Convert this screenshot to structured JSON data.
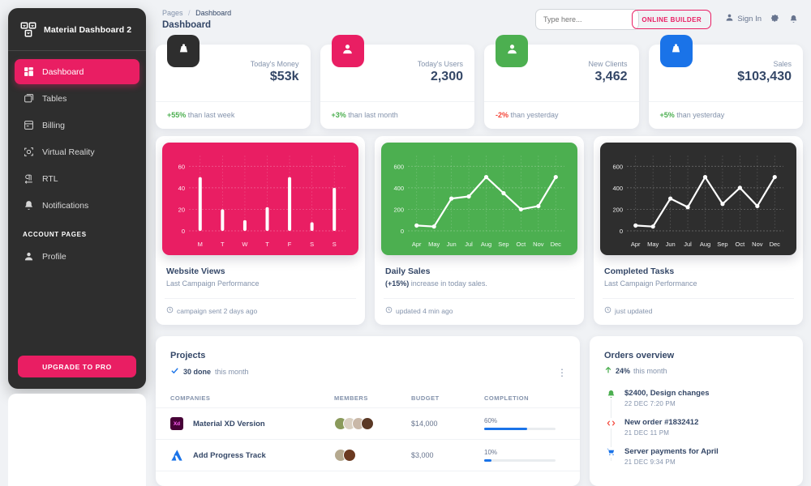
{
  "brand": {
    "name": "Material Dashboard 2",
    "logo_icon": "dashboard-logo-icon"
  },
  "sidebar": {
    "items": [
      {
        "label": "Dashboard",
        "icon": "grid-icon",
        "active": true
      },
      {
        "label": "Tables",
        "icon": "tables-icon",
        "active": false
      },
      {
        "label": "Billing",
        "icon": "credit-card-icon",
        "active": false
      },
      {
        "label": "Virtual Reality",
        "icon": "vr-icon",
        "active": false
      },
      {
        "label": "RTL",
        "icon": "rtl-icon",
        "active": false
      },
      {
        "label": "Notifications",
        "icon": "bell-icon",
        "active": false
      }
    ],
    "section_label": "ACCOUNT PAGES",
    "account_items": [
      {
        "label": "Profile",
        "icon": "person-icon",
        "active": false
      }
    ],
    "upgrade_label": "UPGRADE TO PRO"
  },
  "topbar": {
    "breadcrumb_root": "Pages",
    "breadcrumb_sep": "/",
    "breadcrumb_current": "Dashboard",
    "page_title": "Dashboard",
    "search_placeholder": "Type here...",
    "online_builder_label": "ONLINE BUILDER",
    "sign_in_label": "Sign In",
    "gear_icon": "gear-icon",
    "bell_icon": "bell-icon",
    "person_icon": "person-icon"
  },
  "stats": [
    {
      "label": "Today's Money",
      "value": "$53k",
      "delta": "+55%",
      "delta_color": "#4caf50",
      "foot_rest": " than last week",
      "icon": "weight-icon",
      "bg": "#2e2e2e"
    },
    {
      "label": "Today's Users",
      "value": "2,300",
      "delta": "+3%",
      "delta_color": "#4caf50",
      "foot_rest": " than last month",
      "icon": "person-icon",
      "bg": "#e91e63"
    },
    {
      "label": "New Clients",
      "value": "3,462",
      "delta": "-2%",
      "delta_color": "#f44336",
      "foot_rest": " than yesterday",
      "icon": "person-icon",
      "bg": "#4caf50"
    },
    {
      "label": "Sales",
      "value": "$103,430",
      "delta": "+5%",
      "delta_color": "#4caf50",
      "foot_rest": " than yesterday",
      "icon": "cart-icon",
      "bg": "#1a73e8"
    }
  ],
  "chart_data": [
    {
      "type": "bar",
      "title": "Website Views",
      "subtitle": "Last Campaign Performance",
      "footer": "campaign sent 2 days ago",
      "categories": [
        "M",
        "T",
        "W",
        "T",
        "F",
        "S",
        "S"
      ],
      "values": [
        50,
        20,
        10,
        22,
        50,
        8,
        40
      ],
      "ytick_labels": [
        "60",
        "40",
        "20",
        "0"
      ],
      "ylim": [
        0,
        70
      ],
      "grid": true,
      "panel_color": "#e91e63",
      "series_color": "#ffffff",
      "legend": "none",
      "xlabel": "",
      "ylabel": ""
    },
    {
      "type": "line",
      "title": "Daily Sales",
      "subtitle_bold": "(+15%)",
      "subtitle_rest": " increase in today sales.",
      "footer": "updated 4 min ago",
      "categories": [
        "Apr",
        "May",
        "Jun",
        "Jul",
        "Aug",
        "Sep",
        "Oct",
        "Nov",
        "Dec"
      ],
      "values": [
        50,
        40,
        300,
        320,
        500,
        350,
        200,
        230,
        500
      ],
      "ytick_labels": [
        "600",
        "400",
        "200",
        "0"
      ],
      "ylim": [
        0,
        700
      ],
      "grid": true,
      "panel_color": "#4caf50",
      "series_color": "#ffffff",
      "legend": "none",
      "xlabel": "",
      "ylabel": ""
    },
    {
      "type": "line",
      "title": "Completed Tasks",
      "subtitle": "Last Campaign Performance",
      "footer": "just updated",
      "categories": [
        "Apr",
        "May",
        "Jun",
        "Jul",
        "Aug",
        "Sep",
        "Oct",
        "Nov",
        "Dec"
      ],
      "values": [
        50,
        40,
        300,
        220,
        500,
        250,
        400,
        230,
        500
      ],
      "ytick_labels": [
        "600",
        "400",
        "200",
        "0"
      ],
      "ylim": [
        0,
        700
      ],
      "grid": true,
      "panel_color": "#2e2e2e",
      "series_color": "#ffffff",
      "legend": "none",
      "xlabel": "",
      "ylabel": ""
    }
  ],
  "projects": {
    "title": "Projects",
    "done_count": "30 done",
    "done_rest": " this month",
    "menu_icon": "more-vertical-icon",
    "columns": [
      "COMPANIES",
      "MEMBERS",
      "BUDGET",
      "COMPLETION"
    ],
    "rows": [
      {
        "company": "Material XD Version",
        "logo": "xd-icon",
        "logo_color": "#470137",
        "members": [
          "#8a9a5b",
          "#d9cfc1",
          "#c9b8a8",
          "#5a3825"
        ],
        "budget": "$14,000",
        "completion_label": "60%",
        "completion": 60
      },
      {
        "company": "Add Progress Track",
        "logo": "atlassian-icon",
        "logo_color": "#1a73e8",
        "members": [
          "#b5a98f",
          "#6b3a21"
        ],
        "budget": "$3,000",
        "completion_label": "10%",
        "completion": 10
      }
    ]
  },
  "orders": {
    "title": "Orders overview",
    "delta": "24%",
    "delta_rest": " this month",
    "arrow_icon": "arrow-up-icon",
    "items": [
      {
        "title": "$2400, Design changes",
        "time": "22 DEC 7:20 PM",
        "icon": "bell-icon",
        "color": "#4caf50"
      },
      {
        "title": "New order #1832412",
        "time": "21 DEC 11 PM",
        "icon": "code-icon",
        "color": "#f44336"
      },
      {
        "title": "Server payments for April",
        "time": "21 DEC 9:34 PM",
        "icon": "cart-icon",
        "color": "#1a73e8"
      }
    ]
  }
}
